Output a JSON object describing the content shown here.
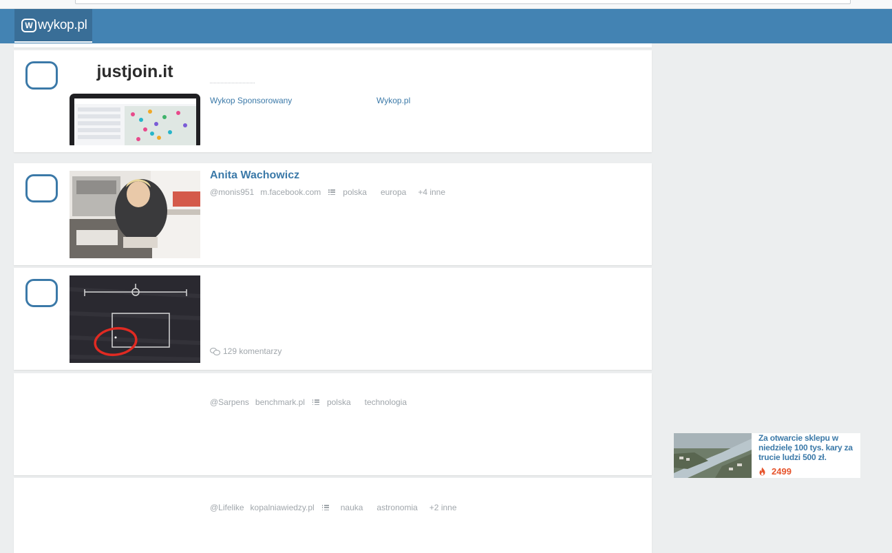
{
  "header": {
    "logo_text": "wykop.pl",
    "logo_mark": "W"
  },
  "colors": {
    "header_bg": "#4383b3",
    "accent": "#3b79a8",
    "hot": "#e6532b"
  },
  "entries": [
    {
      "type": "sponsored",
      "sponsor_label": "Wykop Sponsorowany",
      "source": "Wykop.pl",
      "thumb_brand": "justjoin.it"
    },
    {
      "type": "link",
      "title": "Anita Wachowicz",
      "author": "@monis951",
      "domain": "m.facebook.com",
      "tags": [
        "polska",
        "europa",
        "+4 inne"
      ]
    },
    {
      "type": "link",
      "comments": "129 komentarzy"
    },
    {
      "type": "link",
      "author": "@Sarpens",
      "domain": "benchmark.pl",
      "tags": [
        "polska",
        "technologia"
      ]
    },
    {
      "type": "link",
      "author": "@Lifelike",
      "domain": "kopalniawiedzy.pl",
      "tags": [
        "nauka",
        "astronomia",
        "+2 inne"
      ]
    }
  ],
  "sidebar_ad": {
    "title": "Za otwarcie sklepu w niedzielę 100 tys. kary za trucie ludzi 500 zł.",
    "count": "2499",
    "icon": "flame-icon"
  }
}
